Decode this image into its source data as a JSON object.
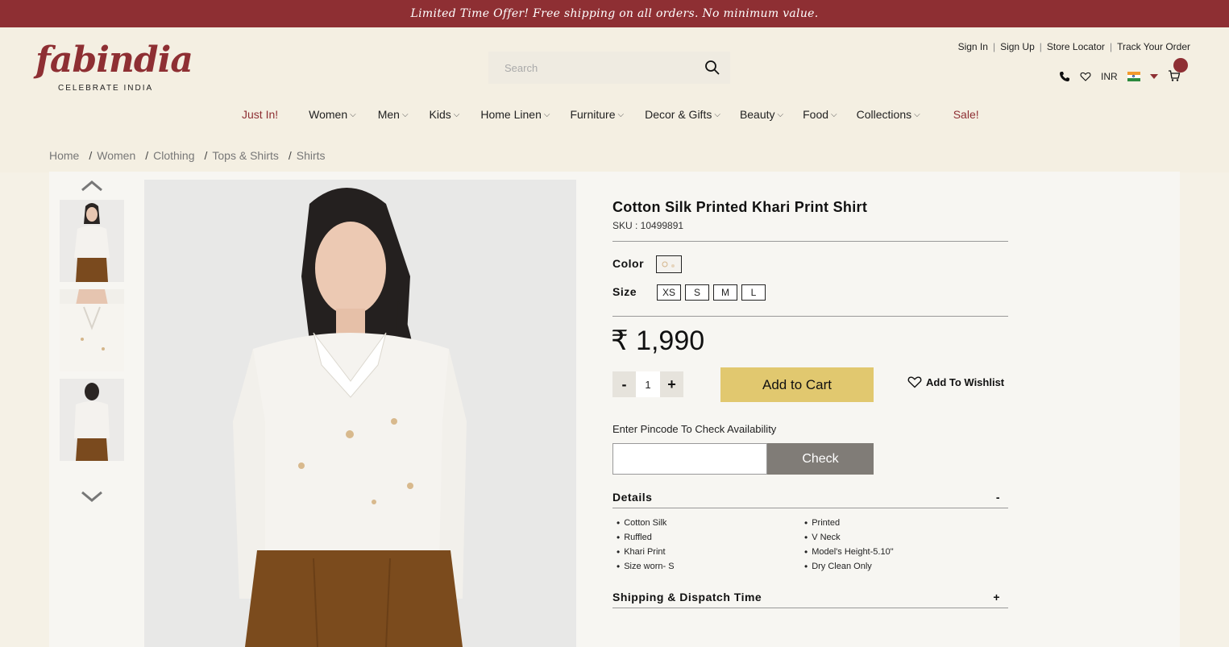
{
  "promo": {
    "text": "Limited Time Offer! Free shipping on all orders. No minimum value."
  },
  "logo": {
    "name": "fabindia",
    "tagline": "CELEBRATE INDIA"
  },
  "search": {
    "placeholder": "Search",
    "value": ""
  },
  "header_links": [
    "Sign In",
    "Sign Up",
    "Store Locator",
    "Track Your Order"
  ],
  "currency": "INR",
  "nav": [
    {
      "label": "Just In!",
      "accent": true,
      "dropdown": false
    },
    {
      "label": "Women",
      "accent": false,
      "dropdown": true
    },
    {
      "label": "Men",
      "accent": false,
      "dropdown": true
    },
    {
      "label": "Kids",
      "accent": false,
      "dropdown": true
    },
    {
      "label": "Home Linen",
      "accent": false,
      "dropdown": true
    },
    {
      "label": "Furniture",
      "accent": false,
      "dropdown": true
    },
    {
      "label": "Decor & Gifts",
      "accent": false,
      "dropdown": true
    },
    {
      "label": "Beauty",
      "accent": false,
      "dropdown": true
    },
    {
      "label": "Food",
      "accent": false,
      "dropdown": true
    },
    {
      "label": "Collections",
      "accent": false,
      "dropdown": true
    },
    {
      "label": "Sale!",
      "accent": true,
      "dropdown": false
    }
  ],
  "breadcrumb": [
    "Home",
    "Women",
    "Clothing",
    "Tops & Shirts",
    "Shirts"
  ],
  "product": {
    "title": "Cotton Silk Printed Khari Print Shirt",
    "sku": "SKU : 10499891",
    "color_label": "Color",
    "size_label": "Size",
    "sizes": [
      "XS",
      "S",
      "M",
      "L"
    ],
    "price": "₹ 1,990",
    "qty": "1",
    "qty_minus": "-",
    "qty_plus": "+",
    "add_to_cart": "Add to Cart",
    "wishlist": "Add To Wishlist"
  },
  "pincode": {
    "label": "Enter Pincode To Check Availability",
    "value": "",
    "button": "Check"
  },
  "details": {
    "heading": "Details",
    "toggle": "-",
    "left": [
      "Cotton Silk",
      "Ruffled",
      "Khari Print",
      "Size worn- S"
    ],
    "right": [
      "Printed",
      "V Neck",
      "Model's Height-5.10\"",
      "Dry Clean Only"
    ]
  },
  "shipping": {
    "heading": "Shipping & Dispatch Time",
    "toggle": "+"
  },
  "colors": {
    "brand": "#8e2f33",
    "cart_button": "#e1c86f",
    "check_button": "#807c77"
  },
  "icons": [
    "search-icon",
    "phone-icon",
    "heart-icon",
    "india-flag-icon",
    "caret-down-icon",
    "cart-icon",
    "chevron-up-icon",
    "chevron-down-icon"
  ]
}
